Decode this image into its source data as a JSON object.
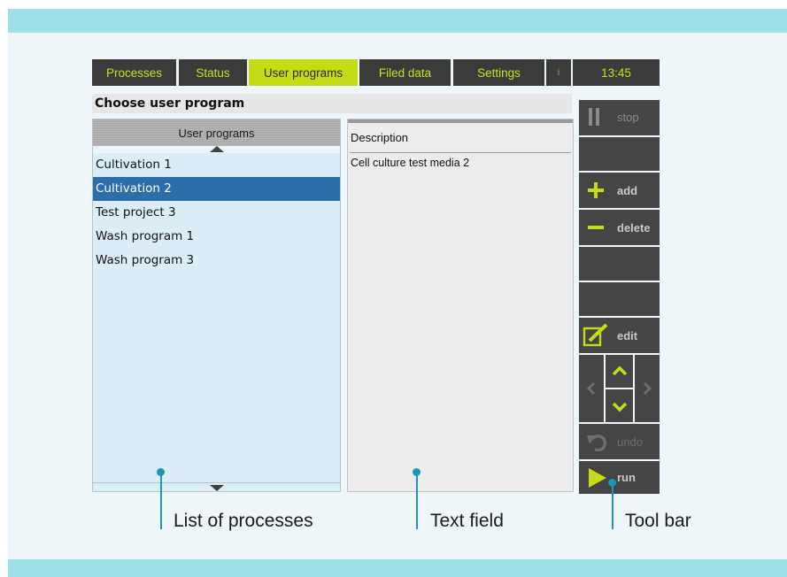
{
  "tabs": [
    {
      "label": "Processes"
    },
    {
      "label": "Status"
    },
    {
      "label": "User programs"
    },
    {
      "label": "Filed data"
    },
    {
      "label": "Settings"
    },
    {
      "label": "i"
    },
    {
      "label": "13:45"
    }
  ],
  "header": {
    "title": "Choose user program"
  },
  "list": {
    "header": "User programs",
    "items": [
      {
        "label": "Cultivation 1"
      },
      {
        "label": "Cultivation 2",
        "selected": true
      },
      {
        "label": "Test project 3"
      },
      {
        "label": "Wash program 1"
      },
      {
        "label": "Wash program 3"
      }
    ]
  },
  "description": {
    "label": "Description",
    "text": "Cell culture test media 2"
  },
  "toolbar": {
    "stop": "stop",
    "add": "add",
    "delete": "delete",
    "edit": "edit",
    "undo": "undo",
    "run": "run"
  },
  "annotations": {
    "list": "List of processes",
    "text": "Text field",
    "toolbar": "Tool bar"
  },
  "colors": {
    "accent": "#c5dc15",
    "selection": "#2c6eaa",
    "callout": "#1f96b4",
    "band": "#9de0e8"
  }
}
